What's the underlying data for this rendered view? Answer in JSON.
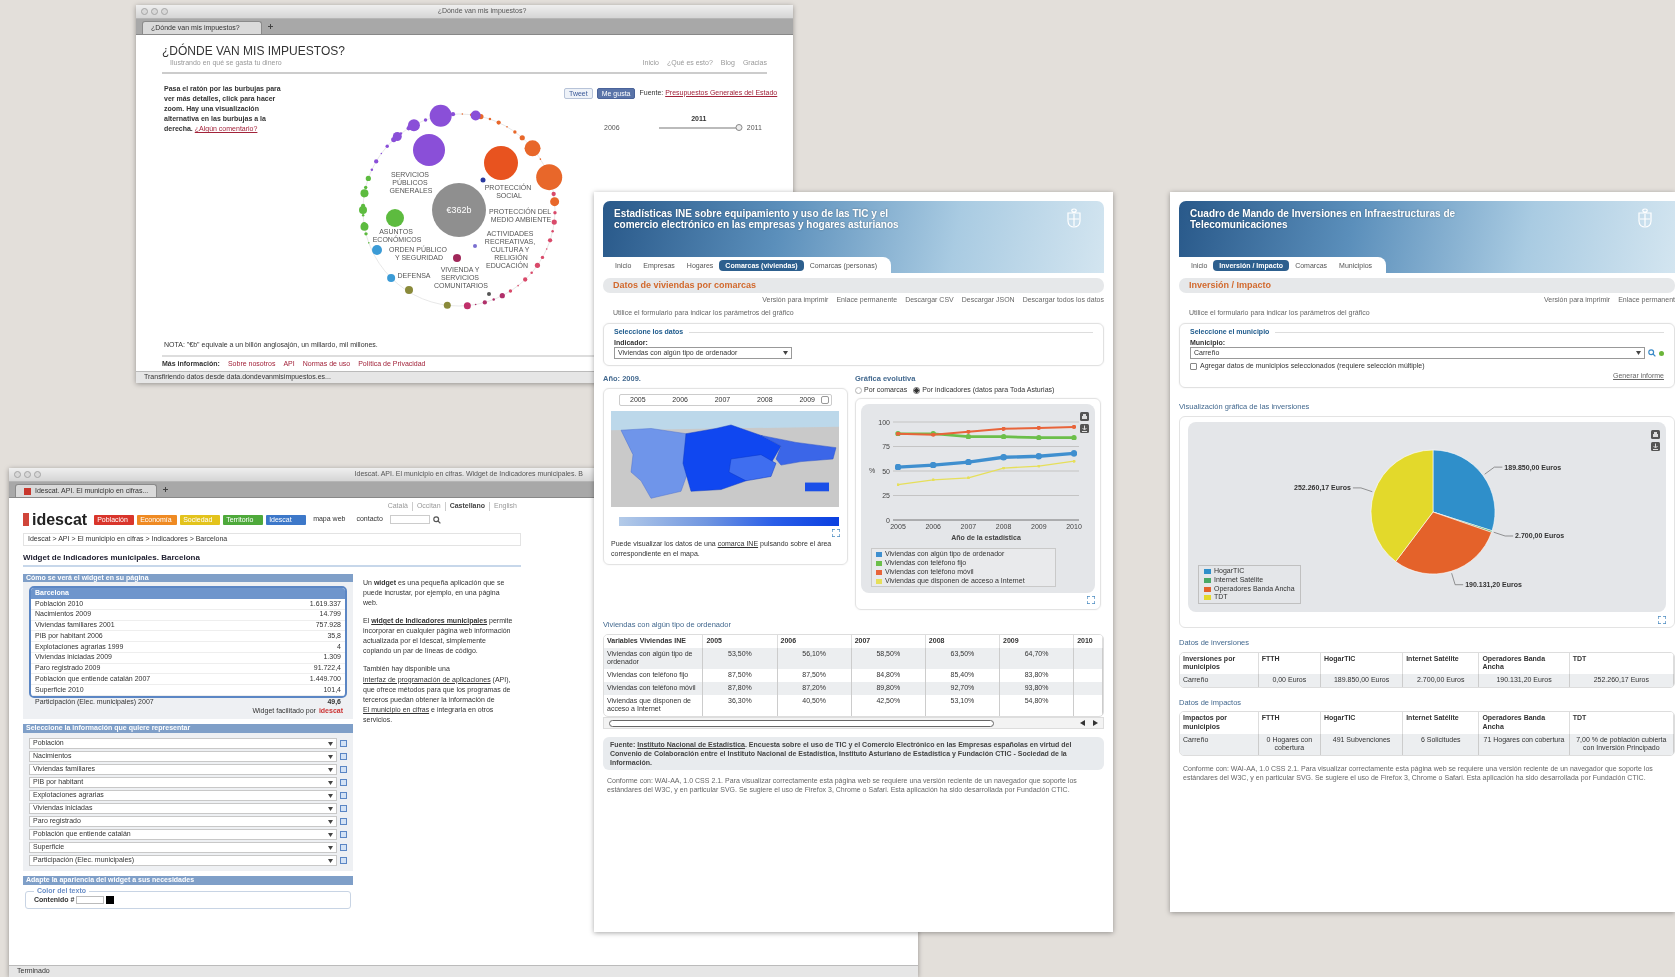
{
  "tax_window": {
    "title": "¿Dónde van mis impuestos?",
    "tab": "¿Dónde van mis impuestos?",
    "heading": "¿DÓNDE VAN MIS IMPUESTOS?",
    "subtitle": "Ilustrando en qué se gasta tu dinero",
    "nav": [
      "Inicio",
      "¿Qué es esto?",
      "Blog",
      "Gracias"
    ],
    "intro": {
      "text": "Pasa el ratón por las burbujas para ver más detalles, click para hacer zoom. Hay una visualización alternativa en las burbujas a la derecha. ",
      "link": "¿Algún comentario?"
    },
    "share_buttons": [
      "Tweet",
      "Me gusta"
    ],
    "source": {
      "label": "Fuente: ",
      "link": "Presupuestos Generales del Estado"
    },
    "year_slider": {
      "min": "2006",
      "max": "2011",
      "value": "2011",
      "level": 1
    },
    "bubble_chart": {
      "total": "€362b",
      "labels": [
        "SERVICIOS PÚBLICOS GENERALES",
        "PROTECCIÓN SOCIAL",
        "ASUNTOS ECONÓMICOS",
        "PROTECCIÓN DEL MEDIO AMBIENTE",
        "ACTIVIDADES RECREATIVAS, CULTURA Y RELIGIÓN",
        "EDUCACIÓN",
        "ORDEN PÚBLICO Y SEGURIDAD",
        "DEFENSA",
        "VIVIENDA Y SERVICIOS COMUNITARIOS"
      ]
    },
    "note": "NOTA: \"€b\" equivale a un billón anglosajón, un millardo, mil millones.",
    "footer": {
      "label": "Más información:",
      "links": [
        "Sobre nosotros",
        "API",
        "Normas de uso",
        "Política de Privacidad"
      ]
    },
    "status": "Transfiriendo datos desde data.dondevanmisimpuestos.es..."
  },
  "idescat_window": {
    "title": "Idescat. API. El municipio en cifras. Widget de Indicadores municipales. B",
    "tab": "Idescat. API. El municipio en cifras...",
    "languages": [
      {
        "label": "Català",
        "selected": false
      },
      {
        "label": "Occitan",
        "selected": false
      },
      {
        "label": "Castellano",
        "selected": true
      },
      {
        "label": "English",
        "selected": false
      }
    ],
    "logo": "idescat",
    "nav": [
      {
        "label": "Población",
        "color": "#d9352b"
      },
      {
        "label": "Economía",
        "color": "#ef8a22"
      },
      {
        "label": "Sociedad",
        "color": "#e3c31c"
      },
      {
        "label": "Territorio",
        "color": "#4ea93b"
      },
      {
        "label": "Idescat",
        "color": "#3d78c9"
      }
    ],
    "links": [
      "mapa web",
      "contacto"
    ],
    "breadcrumb": "Idescat > API > El municipio en cifras > Indicadores > Barcelona",
    "heading": "Widget de Indicadores municipales. Barcelona",
    "preview_section": {
      "title": "Cómo se verá el widget en su página",
      "widget_title": "Barcelona",
      "rows": [
        {
          "label": "Población 2010",
          "value": "1.619.337"
        },
        {
          "label": "Nacimientos 2009",
          "value": "14.799"
        },
        {
          "label": "Viviendas familiares 2001",
          "value": "757.928"
        },
        {
          "label": "PIB por habitant 2006",
          "value": "35,8"
        },
        {
          "label": "Explotaciones agrarias 1999",
          "value": "4"
        },
        {
          "label": "Viviendas iniciadas 2009",
          "value": "1.309"
        },
        {
          "label": "Paro registrado 2009",
          "value": "91.722,4"
        },
        {
          "label": "Población que entiende catalán 2007",
          "value": "1.449.700"
        },
        {
          "label": "Superficie 2010",
          "value": "101,4"
        }
      ],
      "overflow_row": {
        "label": "Participación (Elec. municipales) 2007",
        "value": "49,6"
      },
      "credit": "Widget facilitado por",
      "credit_logo": "idescat"
    },
    "select_section": {
      "title": "Seleccione la información que quiere representar",
      "options": [
        "Población",
        "Nacimientos",
        "Viviendas familiares",
        "PIB por habitant",
        "Explotaciones agrarias",
        "Viviendas iniciadas",
        "Paro registrado",
        "Población que entiende catalán",
        "Superficie",
        "Participación (Elec. municipales)"
      ]
    },
    "style_section": {
      "title": "Adapte la apariencia del widget a sus necesidades",
      "group": "Color del texto",
      "field_label": "Contenido #"
    },
    "side_text": [
      [
        {
          "kind": "text",
          "text": "Un **widget** es una pequeña aplicación que se puede incrustar, por ejemplo, en una página web."
        }
      ],
      [
        {
          "kind": "text",
          "text": "El "
        },
        {
          "kind": "strong_link",
          "text": "widget de Indicadores municipales"
        },
        {
          "kind": "text",
          "text": " permite incorporar en cualquier página web información actualizada por el Idescat, simplemente copiando un par de líneas de código."
        }
      ],
      [
        {
          "kind": "text",
          "text": "También hay disponible una "
        },
        {
          "kind": "link",
          "text": "interfaz de programación de aplicaciones"
        },
        {
          "kind": "text",
          "text": " (API), que ofrece métodos para que los programas de terceros puedan obtener la información de "
        },
        {
          "kind": "link",
          "text": "El municipio en cifras"
        },
        {
          "kind": "text",
          "text": " e integrarla en otros servicios."
        }
      ]
    ],
    "status": "Terminado"
  },
  "ine_window": {
    "banner_title": "Estadísticas INE sobre equipamiento y uso de las TIC y el comercio electrónico en las empresas y hogares asturianos",
    "tabs": [
      {
        "label": "Inicio",
        "selected": false
      },
      {
        "label": "Empresas",
        "selected": false
      },
      {
        "label": "Hogares",
        "selected": false
      },
      {
        "label": "Comarcas (viviendas)",
        "selected": true
      },
      {
        "label": "Comarcas (personas)",
        "selected": false
      }
    ],
    "heading": "Datos de viviendas por comarcas",
    "actions": [
      "Versión para imprimir",
      "Enlace permanente",
      "Descargar CSV",
      "Descargar JSON",
      "Descargar todos los datos"
    ],
    "hint": "Utilice el formulario para indicar los parámetros del gráfico",
    "form": {
      "legend": "Seleccione los datos",
      "label": "Indicador:",
      "value": "Viviendas con algún tipo de ordenador"
    },
    "map_panel": {
      "title": "Año: 2009.",
      "year_slider": {
        "labels": [
          "2005",
          "2006",
          "2007",
          "2008",
          "2009"
        ],
        "level": 1
      },
      "caption": [
        {
          "kind": "text",
          "text": "Puede visualizar los datos de una "
        },
        {
          "kind": "link",
          "text": "comarca INE"
        },
        {
          "kind": "text",
          "text": " pulsando sobre el área correspondiente en el mapa."
        }
      ]
    },
    "chart_panel": {
      "title": "Gráfica evolutiva",
      "modes": [
        {
          "label": "Por comarcas",
          "selected": false
        },
        {
          "label": "Por indicadores (datos para Toda Asturias)",
          "selected": true
        }
      ],
      "chart_data": {
        "type": "line",
        "xlabel": "Año de la estadística",
        "ylabel": "%",
        "categories": [
          "2005",
          "2006",
          "2007",
          "2008",
          "2009",
          "2010"
        ],
        "ylim": [
          0,
          100
        ],
        "yticks": [
          0,
          25,
          50,
          75,
          100
        ],
        "grid": true,
        "series": [
          {
            "name": "Viviendas con algún tipo de ordenador",
            "color": "#3f8fcf",
            "values": [
              54,
              56,
              59,
              64,
              65,
              68
            ]
          },
          {
            "name": "Viviendas con teléfono fijo",
            "color": "#6cbf4a",
            "values": [
              88,
              88,
              85,
              85,
              84,
              84
            ]
          },
          {
            "name": "Viviendas con teléfono móvil",
            "color": "#e8643a",
            "values": [
              88,
              87,
              90,
              93,
              94,
              95
            ]
          },
          {
            "name": "Viviendas que disponen de acceso a Internet",
            "color": "#e6df5a",
            "values": [
              36,
              41,
              43,
              53,
              55,
              60
            ]
          }
        ]
      }
    },
    "table": {
      "title": "Viviendas con algún tipo de ordenador",
      "columns": [
        "Variables Viviendas INE",
        "2005",
        "2006",
        "2007",
        "2008",
        "2009",
        "2010"
      ],
      "rows": [
        [
          "Viviendas con algún tipo de ordenador",
          "53,50%",
          "56,10%",
          "58,50%",
          "63,50%",
          "64,70%"
        ],
        [
          "Viviendas con teléfono fijo",
          "87,50%",
          "87,50%",
          "84,80%",
          "85,40%",
          "83,80%"
        ],
        [
          "Viviendas con teléfono móvil",
          "87,80%",
          "87,20%",
          "89,80%",
          "92,70%",
          "93,80%"
        ],
        [
          "Viviendas que disponen de acceso a Internet",
          "36,30%",
          "40,50%",
          "42,50%",
          "53,10%",
          "54,80%"
        ]
      ]
    },
    "source": [
      {
        "kind": "text",
        "text": "Fuente: "
      },
      {
        "kind": "link",
        "text": "Instituto Nacional de Estadística"
      },
      {
        "kind": "text",
        "text": ". Encuesta sobre el uso de TIC y el Comercio Electrónico en las Empresas españolas en virtud del Convenio de Colaboración entre el Instituto Nacional de Estadística, Instituto Asturiano de Estadística y Fundación CTIC - Sociedad de la Información."
      }
    ],
    "footer": "Conforme con: WAI-AA, 1.0 CSS 2.1. Para visualizar correctamente esta página web se requiere una versión reciente de un navegador que soporte los estándares del W3C, y en particular SVG. Se sugiere el uso de Firefox 3, Chrome o Safari. Esta aplicación ha sido desarrollada por Fundación CTIC."
  },
  "invest_window": {
    "banner_title": "Cuadro de Mando de Inversiones en Infraestructuras de Telecomunicaciones",
    "tabs": [
      {
        "label": "Inicio",
        "selected": false
      },
      {
        "label": "Inversión / Impacto",
        "selected": true
      },
      {
        "label": "Comarcas",
        "selected": false
      },
      {
        "label": "Municipios",
        "selected": false
      }
    ],
    "heading": "Inversión / Impacto",
    "actions": [
      "Versión para imprimir",
      "Enlace permanent"
    ],
    "hint": "Utilice el formulario para indicar los parámetros del gráfico",
    "form": {
      "legend": "Seleccione el municipio",
      "label": "Municipio:",
      "value": "Carreño",
      "aggregate": {
        "label": "Agregar datos de municipios seleccionados (requiere selección múltiple)",
        "checked": false
      },
      "submit": "Generar informe"
    },
    "chart_title": "Visualización gráfica de las inversiones",
    "chart_data": {
      "type": "pie",
      "categories": [
        "HogarTIC",
        "Internet Satélite",
        "Operadores Banda Ancha",
        "TDT"
      ],
      "values": [
        189850,
        2700,
        190131.2,
        252260.17
      ],
      "colors": [
        "#2f8fca",
        "#4aa866",
        "#e4622a",
        "#e3d92b"
      ],
      "value_labels": [
        "189.850,00 Euros",
        "2.700,00 Euros",
        "190.131,20 Euros",
        "252.260,17 Euros"
      ]
    },
    "investments": {
      "title": "Datos de inversiones",
      "columns": [
        "Inversiones por municipios",
        "FTTH",
        "HogarTIC",
        "Internet Satélite",
        "Operadores Banda Ancha",
        "TDT"
      ],
      "rows": [
        [
          "Carreño",
          "0,00 Euros",
          "189.850,00 Euros",
          "2.700,00 Euros",
          "190.131,20 Euros",
          "252.260,17 Euros"
        ]
      ]
    },
    "impacts": {
      "title": "Datos de impactos",
      "columns": [
        "Impactos por municipios",
        "FTTH",
        "HogarTIC",
        "Internet Satélite",
        "Operadores Banda Ancha",
        "TDT"
      ],
      "rows": [
        [
          "Carreño",
          "0 Hogares con cobertura",
          "491 Subvenciones",
          "6 Solicitudes",
          "71 Hogares con cobertura",
          "7,00 % de población cubierta con Inversión Principado"
        ]
      ]
    },
    "footer": "Conforme con: WAI-AA, 1.0 CSS 2.1. Para visualizar correctamente esta página web se requiere una versión reciente de un navegador que soporte los estándares del W3C, y en particular SVG. Se sugiere el uso de Firefox 3, Chrome o Safari. Esta aplicación ha sido desarrollada por Fundación CTIC."
  }
}
